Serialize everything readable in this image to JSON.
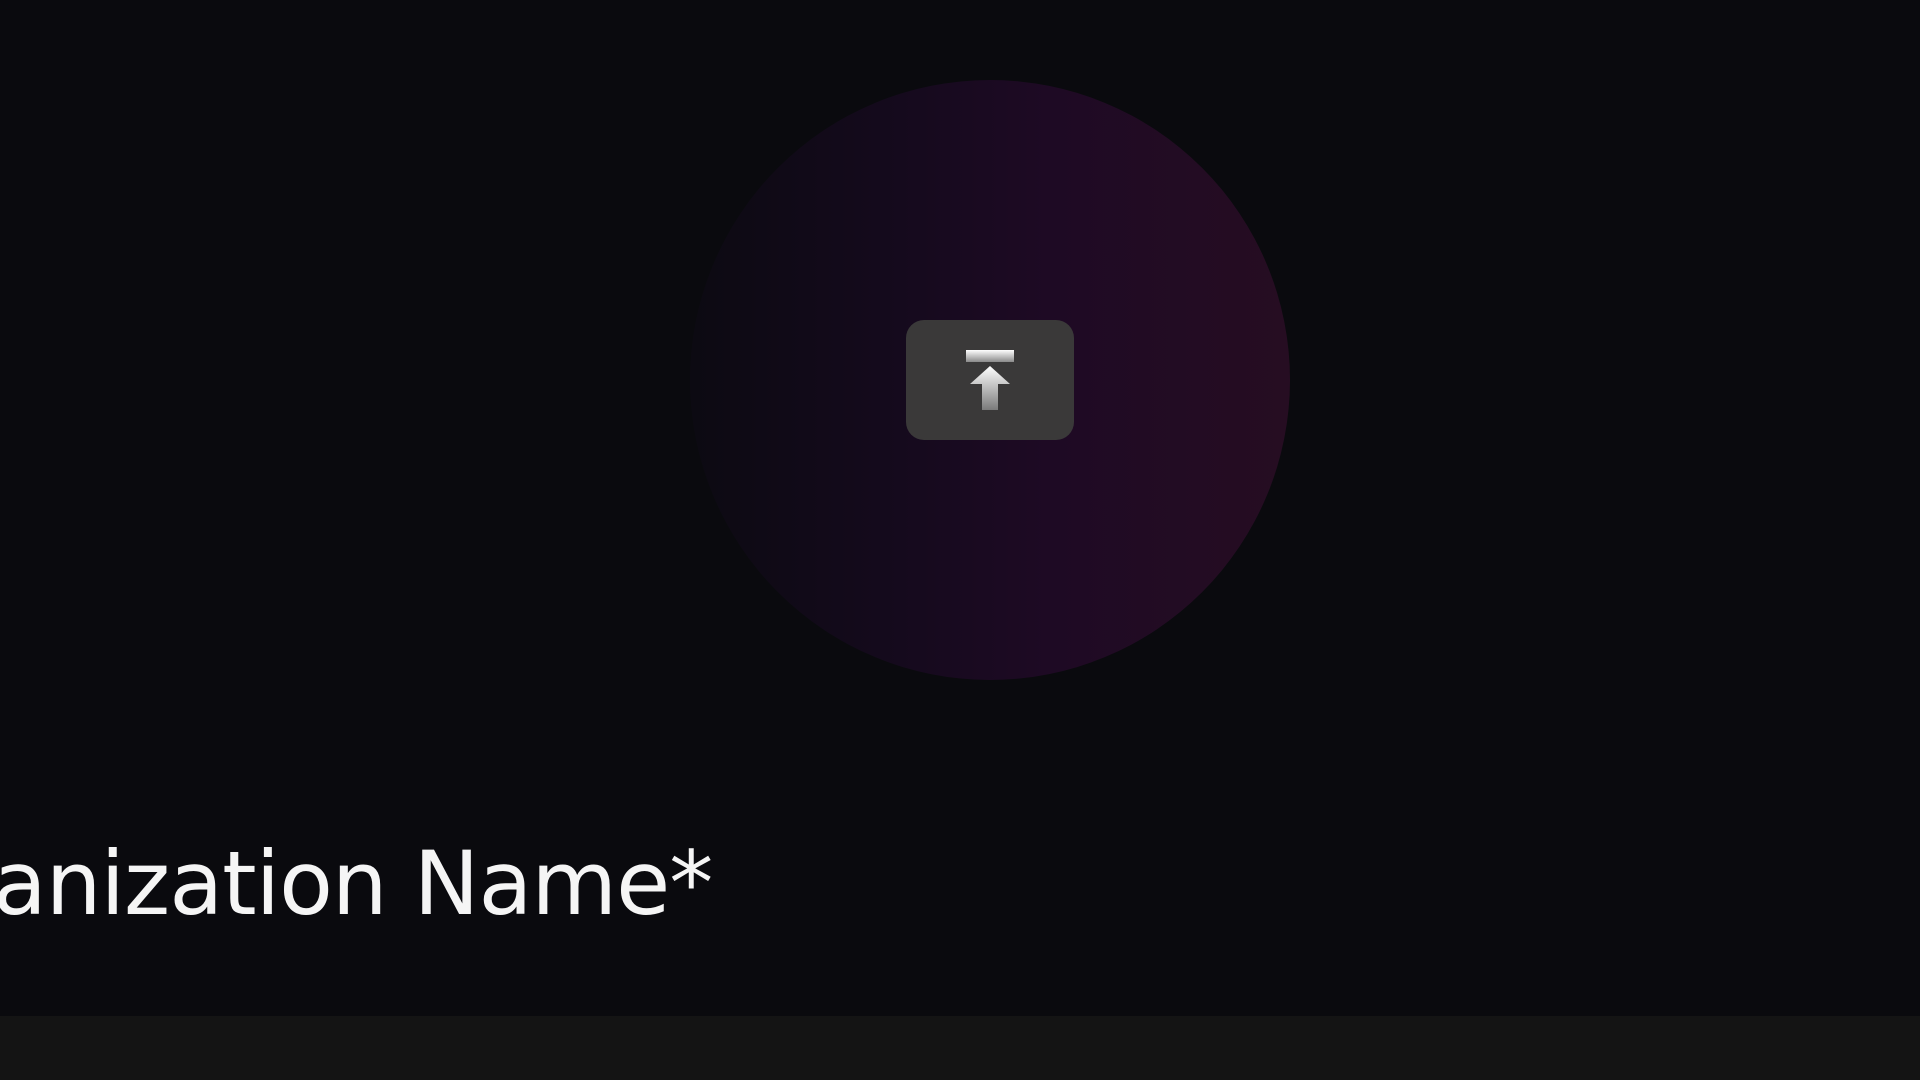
{
  "avatar": {
    "upload_icon": "upload-arrow-icon",
    "glow_colors": [
      "#0c0a12",
      "#150a1d",
      "#1e0a24",
      "#260d22"
    ]
  },
  "form": {
    "org_name_label": "ganization Name*",
    "org_name_value": ""
  },
  "colors": {
    "background": "#0a0a0e",
    "button": "#3a3939",
    "label_text": "#f5f5f5",
    "input_background": "#141414"
  }
}
